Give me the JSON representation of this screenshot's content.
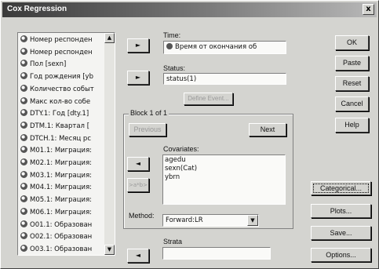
{
  "window": {
    "title": "Cox Regression",
    "close_glyph": "x"
  },
  "variables": [
    "Номер респонден",
    "Номер респонден",
    "Пол [sexn]",
    "Год рождения [yb",
    "Количество событ",
    "Макс кол-во собе",
    "DTY.1: Год [dty.1]",
    "DTM.1: Квартал [",
    "DTCH.1: Месяц рс",
    "M01.1: Миграция:",
    "M02.1: Миграция:",
    "M03.1: Миграция:",
    "M04.1: Миграция:",
    "M05.1: Миграция:",
    "M06.1: Миграция:",
    "O01.1: Образован",
    "O02.1: Образован",
    "O03.1: Образован"
  ],
  "time": {
    "label": "Time:",
    "value": "Время от окончания об"
  },
  "status": {
    "label": "Status:",
    "value": "status(1)",
    "define_event": "Define Event..."
  },
  "block": {
    "label": "Block 1 of 1",
    "previous": "Previous",
    "next": "Next"
  },
  "covariates": {
    "label": "Covariates:",
    "items": [
      "agedu",
      "sexn(Cat)",
      "ybrn"
    ],
    "interaction_btn": ">a*b>"
  },
  "method": {
    "label": "Method:",
    "value": "Forward:LR"
  },
  "strata": {
    "label": "Strata",
    "value": ""
  },
  "buttons": {
    "ok": "OK",
    "paste": "Paste",
    "reset": "Reset",
    "cancel": "Cancel",
    "help": "Help",
    "categorical": "Categorical...",
    "plots": "Plots...",
    "save": "Save...",
    "options": "Options..."
  },
  "arrows": {
    "right": "►",
    "left": "◄"
  }
}
